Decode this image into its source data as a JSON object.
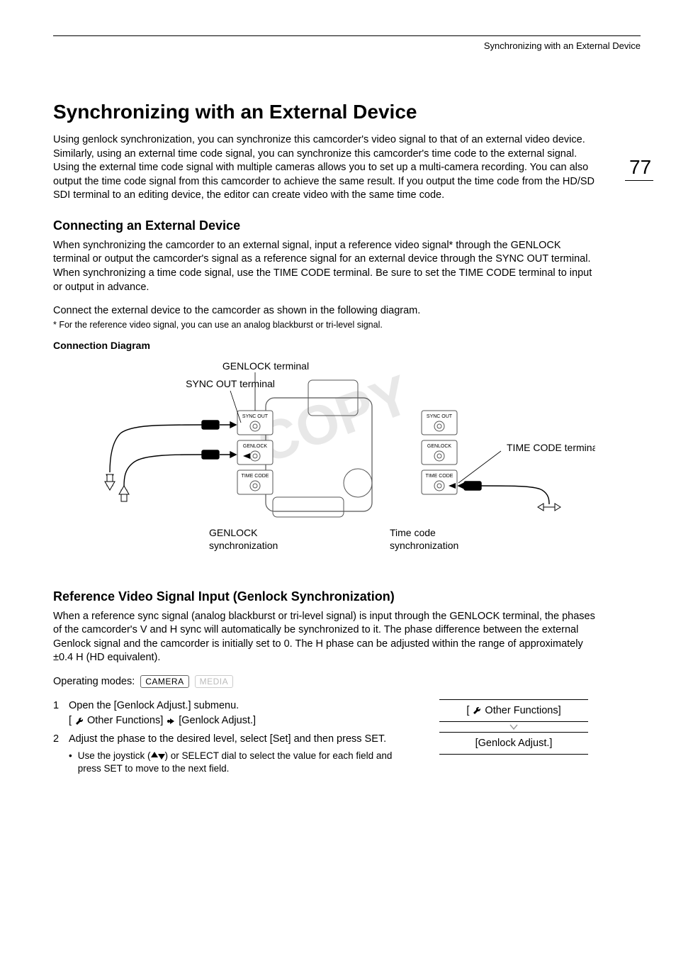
{
  "running_head": "Synchronizing with an External Device",
  "page_number": "77",
  "h1": "Synchronizing with an External Device",
  "intro": "Using genlock synchronization, you can synchronize this camcorder's video signal to that of an external video device. Similarly, using an external time code signal, you can synchronize this camcorder's time code to the external signal. Using the external time code signal with multiple cameras allows you to set up a multi-camera recording. You can also output the time code signal from this camcorder to achieve the same result. If you output the time code from the HD/SD SDI terminal to an editing device, the editor can create video with the same time code.",
  "h2a": "Connecting an External Device",
  "body_a1": "When synchronizing the camcorder to an external signal, input a reference video signal* through the GENLOCK terminal or output the camcorder's signal as a reference signal for an external device through the SYNC OUT terminal.",
  "body_a2": "When synchronizing a time code signal, use the TIME CODE terminal. Be sure to set the TIME CODE terminal to input or output in advance.",
  "body_a3": "Connect the external device to the camcorder as shown in the following diagram.",
  "footnote_a": "*  For the reference video signal, you can use an analog blackburst or tri-level signal.",
  "diagram_title": "Connection Diagram",
  "diagram": {
    "genlock_terminal": "GENLOCK terminal",
    "syncout_terminal": "SYNC OUT terminal",
    "timecode_terminal": "TIME CODE terminal",
    "genlock_sync": "GENLOCK synchronization",
    "timecode_sync": "Time code synchronization",
    "port_syncout": "SYNC OUT",
    "port_genlock": "GENLOCK",
    "port_timecode": "TIME CODE",
    "watermark": "COPY"
  },
  "h2b": "Reference Video Signal Input (Genlock Synchronization)",
  "body_b1": "When a reference sync signal (analog blackburst or tri-level signal) is input through the GENLOCK terminal, the phases of the camcorder's V and H sync will automatically be synchronized to it. The phase difference between the external Genlock signal and the camcorder is initially set to 0. The H phase can be adjusted within the range of approximately ±0.4 H (HD equivalent).",
  "op_modes_label": "Operating modes:",
  "mode_camera": "CAMERA",
  "mode_media": "MEDIA",
  "steps": {
    "s1_title": "Open the [Genlock Adjust.] submenu.",
    "s1_sub_a": "Other Functions]",
    "s1_sub_b": "[Genlock Adjust.]",
    "s2_title": "Adjust the phase to the desired level, select [Set] and then press SET.",
    "s2_bullet": "Use the joystick (",
    "s2_bullet_tail": ") or SELECT dial to select the value for each field and press SET to move to the next field."
  },
  "menu": {
    "item1": "Other Functions]",
    "item2": "[Genlock Adjust.]"
  }
}
